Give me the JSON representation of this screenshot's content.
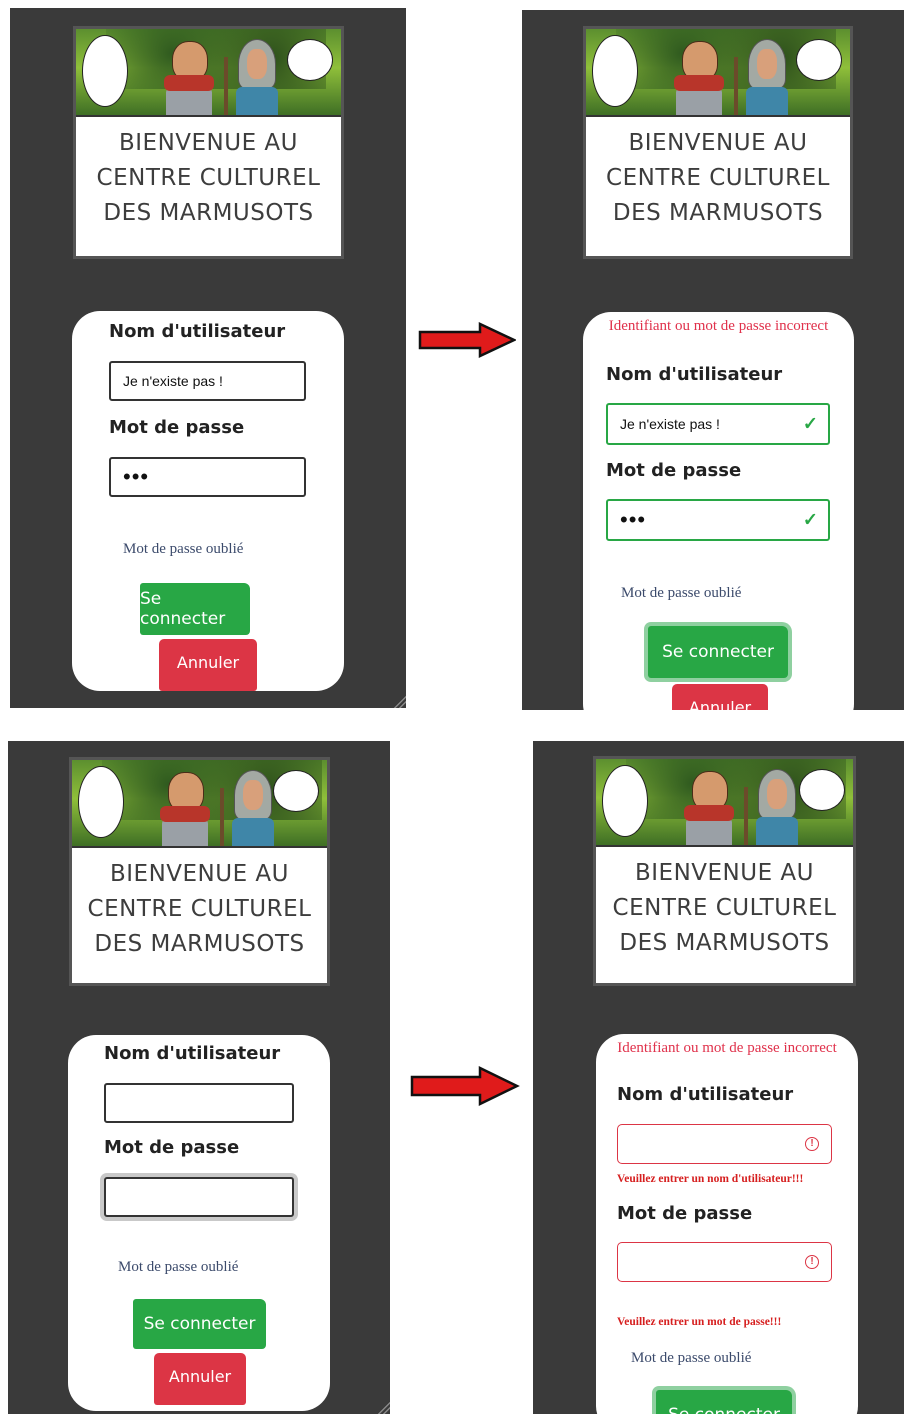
{
  "app": {
    "welcome_line1": "BIENVENUE AU",
    "welcome_line2": "CENTRE CULTUREL",
    "welcome_line3": "DES MARMUSOTS"
  },
  "form": {
    "username_label": "Nom d'utilisateur",
    "password_label": "Mot de passe",
    "forgot_link": "Mot de passe oublié",
    "login_button": "Se connecter",
    "cancel_button": "Annuler",
    "error_banner": "Identifiant ou mot de passe incorrect",
    "username_required": "Veuillez entrer un nom d'utilisateur!!!",
    "password_required": "Veuillez entrer un mot de passe!!!"
  },
  "panels": [
    {
      "username_value": "Je n'existe pas !",
      "password_value": "•••"
    },
    {
      "username_value": "Je n'existe pas !",
      "password_value": "•••"
    },
    {
      "username_value": "",
      "password_value": ""
    },
    {
      "username_value": "",
      "password_value": ""
    }
  ],
  "icons": {
    "valid": "check-icon",
    "invalid": "warning-circle-icon",
    "transition": "right-arrow-icon"
  },
  "colors": {
    "background": "#3a3a3a",
    "success": "#28a745",
    "danger": "#dc3545",
    "error_text": "#e0314b",
    "arrow": "#e01b1b"
  }
}
